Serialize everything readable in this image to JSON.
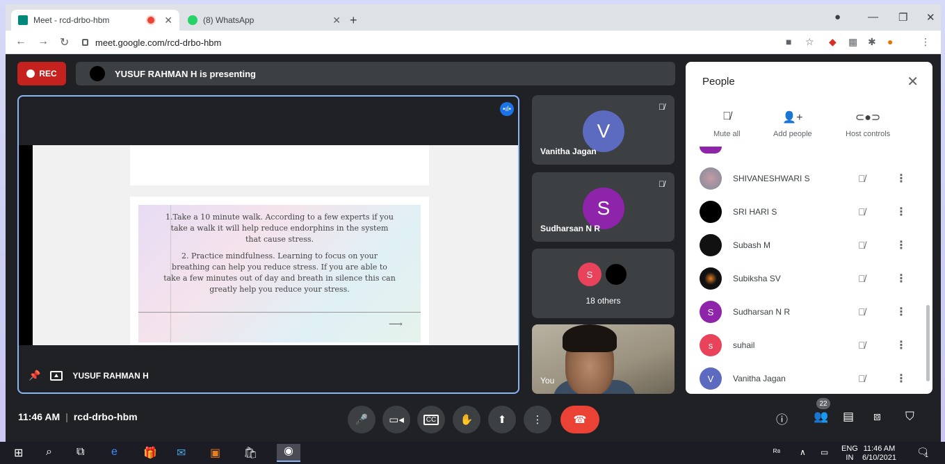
{
  "browser": {
    "tabs": [
      {
        "title": "Meet - rcd-drbo-hbm",
        "active": true,
        "recording": true
      },
      {
        "title": "(8) WhatsApp",
        "active": false
      }
    ],
    "url": "meet.google.com/rcd-drbo-hbm"
  },
  "meet": {
    "rec_label": "REC",
    "presenting_text": "YUSUF RAHMAN H is presenting",
    "main_tile": {
      "presenter_name": "YUSUF RAHMAN H",
      "slide": {
        "paragraph_1": "1.Take a 10 minute walk. According to a few experts if you take a walk it will help reduce endorphins in the system that cause stress.",
        "paragraph_2": "2. Practice mindfulness. Learning to focus on your breathing can help you reduce stress. If you are able to take a few minutes out of day and breath in silence this can greatly help you reduce your stress.",
        "arrow": "⟶"
      }
    },
    "side_tiles": [
      {
        "name": "Vanitha Jagan",
        "initial": "V",
        "color": "#5c6bc0"
      },
      {
        "name": "Sudharsan N R",
        "initial": "S",
        "color": "#8e24aa"
      },
      {
        "others_label": "18 others",
        "mini_initial": "S",
        "mini_color": "#e8435a"
      },
      {
        "name": "You"
      }
    ],
    "people_panel": {
      "title": "People",
      "controls": {
        "mute_all": "Mute all",
        "add_people": "Add people",
        "host_controls": "Host controls"
      },
      "participants": [
        {
          "name": "SHIVANESHWARI S",
          "initial": "",
          "color": "#9e9e9e"
        },
        {
          "name": "SRI HARI S",
          "initial": "",
          "color": "#000000"
        },
        {
          "name": "Subash M",
          "initial": "",
          "color": "#111111"
        },
        {
          "name": "Subiksha SV",
          "initial": "",
          "color": "#111111"
        },
        {
          "name": "Sudharsan N R",
          "initial": "S",
          "color": "#8e24aa"
        },
        {
          "name": "suhail",
          "initial": "s",
          "color": "#e8435a"
        },
        {
          "name": "Vanitha Jagan",
          "initial": "V",
          "color": "#5c6bc0"
        }
      ]
    },
    "bottom": {
      "time": "11:46 AM",
      "meeting_code": "rcd-drbo-hbm",
      "participant_count": "22"
    }
  },
  "taskbar": {
    "lang_top": "ENG",
    "lang_bottom": "IN",
    "time": "11:46 AM",
    "date": "6/10/2021",
    "notification_count": "1"
  }
}
